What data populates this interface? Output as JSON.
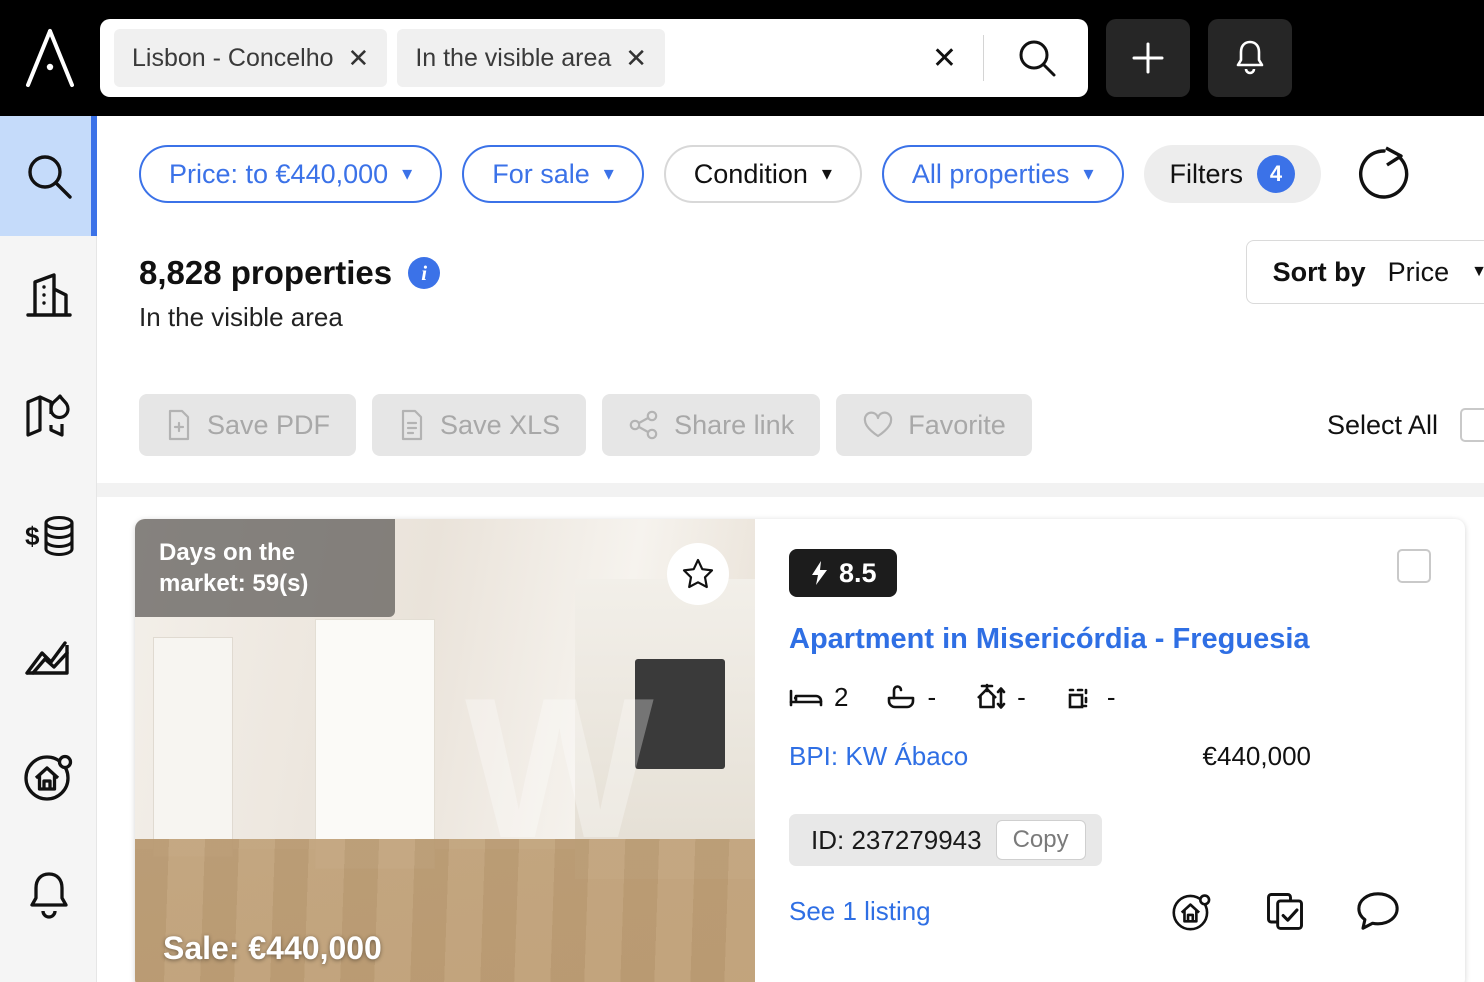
{
  "topbar": {
    "logo_name": "brand-logo",
    "search_chips": [
      {
        "label": "Lisbon - Concelho"
      },
      {
        "label": "In the visible area"
      }
    ],
    "clear_label": "✕",
    "search_icon": "search-icon",
    "add_button_icon": "plus-icon",
    "alerts_button_icon": "bell-icon"
  },
  "sidebar": {
    "items": [
      {
        "icon": "search-icon",
        "active": true
      },
      {
        "icon": "building-icon",
        "active": false
      },
      {
        "icon": "map-heat-icon",
        "active": false
      },
      {
        "icon": "money-coins-icon",
        "active": false
      },
      {
        "icon": "chart-mountain-icon",
        "active": false
      },
      {
        "icon": "home-circle-icon",
        "active": false
      },
      {
        "icon": "bell-icon",
        "active": false
      }
    ]
  },
  "filters": {
    "chips": [
      {
        "label": "Price: to €440,000",
        "style": "active"
      },
      {
        "label": "For sale",
        "style": "active"
      },
      {
        "label": "Condition",
        "style": "neutral"
      },
      {
        "label": "All properties",
        "style": "active"
      }
    ],
    "filters_label": "Filters",
    "filters_count": "4",
    "reset_icon": "reset-circle-icon",
    "accent_color": "#3b72e8"
  },
  "results": {
    "count_label": "8,828 properties",
    "info_icon": "info-icon",
    "info_glyph": "i",
    "subtitle": "In the visible area",
    "sort": {
      "label": "Sort by",
      "value": "Price",
      "caret": "▼"
    },
    "actions": [
      {
        "label": "Save PDF",
        "icon": "file-plus-icon"
      },
      {
        "label": "Save XLS",
        "icon": "file-lines-icon"
      },
      {
        "label": "Share link",
        "icon": "share-icon"
      },
      {
        "label": "Favorite",
        "icon": "heart-icon"
      }
    ],
    "select_all_label": "Select All"
  },
  "listing": {
    "days_on_market": "Days on the market: 59(s)",
    "favorite_icon": "star-icon",
    "photo_watermark": "W",
    "sale_overlay": "Sale: €440,000",
    "score": "8.5",
    "score_icon": "lightning-icon",
    "title": "Apartment in Misericórdia - Freguesia",
    "specs": [
      {
        "icon": "bed-icon",
        "value": "2"
      },
      {
        "icon": "bath-icon",
        "value": "-"
      },
      {
        "icon": "built-area-icon",
        "value": "-"
      },
      {
        "icon": "plot-area-icon",
        "value": "-"
      }
    ],
    "agency": "BPI: KW Ábaco",
    "price": "€440,000",
    "id_label": "ID: 237279943",
    "copy_label": "Copy",
    "see_listing": "See 1 listing",
    "card_icons": [
      {
        "icon": "home-circle-icon"
      },
      {
        "icon": "copy-check-icon"
      },
      {
        "icon": "chat-bubble-icon"
      }
    ]
  }
}
